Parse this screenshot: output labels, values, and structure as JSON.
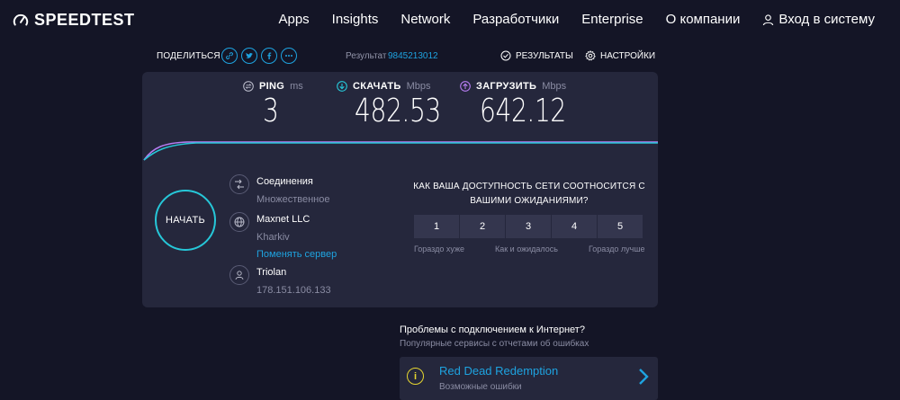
{
  "header": {
    "logo": "SPEEDTEST",
    "nav": [
      {
        "label": "Apps"
      },
      {
        "label": "Insights"
      },
      {
        "label": "Network"
      },
      {
        "label": "Разработчики"
      },
      {
        "label": "Enterprise"
      },
      {
        "label": "О компании"
      }
    ],
    "login_label": "Вход в систему"
  },
  "share": {
    "label": "ПОДЕЛИТЬСЯ",
    "result_label": "Результат",
    "result_id": "9845213012",
    "results_label": "РЕЗУЛЬТАТЫ",
    "settings_label": "НАСТРОЙКИ"
  },
  "metrics": {
    "ping": {
      "name": "PING",
      "unit": "ms",
      "value": "3"
    },
    "download": {
      "name": "СКАЧАТЬ",
      "unit": "Mbps",
      "value": "482.53"
    },
    "upload": {
      "name": "ЗАГРУЗИТЬ",
      "unit": "Mbps",
      "value": "642.12"
    }
  },
  "start_button": "НАЧАТЬ",
  "connection": {
    "connections_title": "Соединения",
    "connections_value": "Множественное",
    "server_name": "Maxnet LLC",
    "server_city": "Kharkiv",
    "change_server": "Поменять сервер",
    "provider_name": "Triolan",
    "provider_ip": "178.151.106.133"
  },
  "survey": {
    "question": "КАК ВАША ДОСТУПНОСТЬ СЕТИ СООТНОСИТСЯ С ВАШИМИ ОЖИДАНИЯМИ?",
    "options": [
      "1",
      "2",
      "3",
      "4",
      "5"
    ],
    "label_low": "Гораздо хуже",
    "label_mid": "Как и ожидалось",
    "label_high": "Гораздо лучше"
  },
  "issues": {
    "title": "Проблемы с подключением к Интернет?",
    "subtitle": "Популярные сервисы с отчетами об ошибках",
    "card_name": "Red Dead Redemption",
    "card_desc": "Возможные ошибки"
  },
  "colors": {
    "background": "#141526",
    "panel": "#25273c",
    "accent_blue": "#1ea3e0",
    "accent_cyan": "#26c7d8",
    "upload_purple": "#b57cf0",
    "warning_yellow": "#e6d630"
  }
}
